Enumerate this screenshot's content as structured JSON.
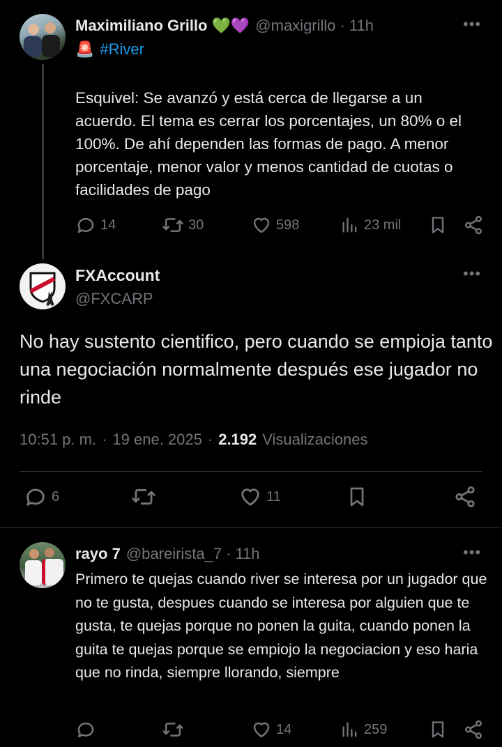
{
  "parent": {
    "name": "Maximiliano Grillo",
    "badges": "💚💜",
    "handle": "@maxigrillo",
    "sep": "·",
    "time": "11h",
    "more": "•••",
    "emoji": "🚨",
    "hashtag": "#River",
    "text": "Esquivel: Se avanzó y está cerca de llegarse a un acuerdo. El tema es cerrar los porcentajes, un 80% o el 100%. De ahí dependen las formas de pago. A menor porcentaje, menor valor y menos cantidad de cuotas o facilidades de pago",
    "replies": "14",
    "reposts": "30",
    "likes": "598",
    "views": "23 mil"
  },
  "main": {
    "name": "FXAccount",
    "handle": "@FXCARP",
    "more": "•••",
    "text": "No hay sustento cientifico, pero cuando se empioja tanto una negociación normalmente después ese jugador no rinde",
    "time": "10:51 p. m.",
    "date": "19 ene. 2025",
    "views_count": "2.192",
    "views_label": "Visualizaciones",
    "replies": "6",
    "likes": "11"
  },
  "reply": {
    "name": "rayo 7",
    "handle": "@bareirista_7",
    "sep": "·",
    "time": "11h",
    "more": "•••",
    "text": "Primero te quejas cuando river se interesa por un jugador que no te gusta, despues cuando se interesa por alguien que te gusta, te quejas porque no ponen la guita, cuando ponen la guita te quejas porque se empiojo la negociacion y eso haria que no rinda, siempre llorando, siempre",
    "likes": "14",
    "views": "259"
  },
  "colors": {
    "accent": "#1d9bf0",
    "muted": "#71767b",
    "text": "#e7e9ea",
    "divider": "#2f3336"
  }
}
